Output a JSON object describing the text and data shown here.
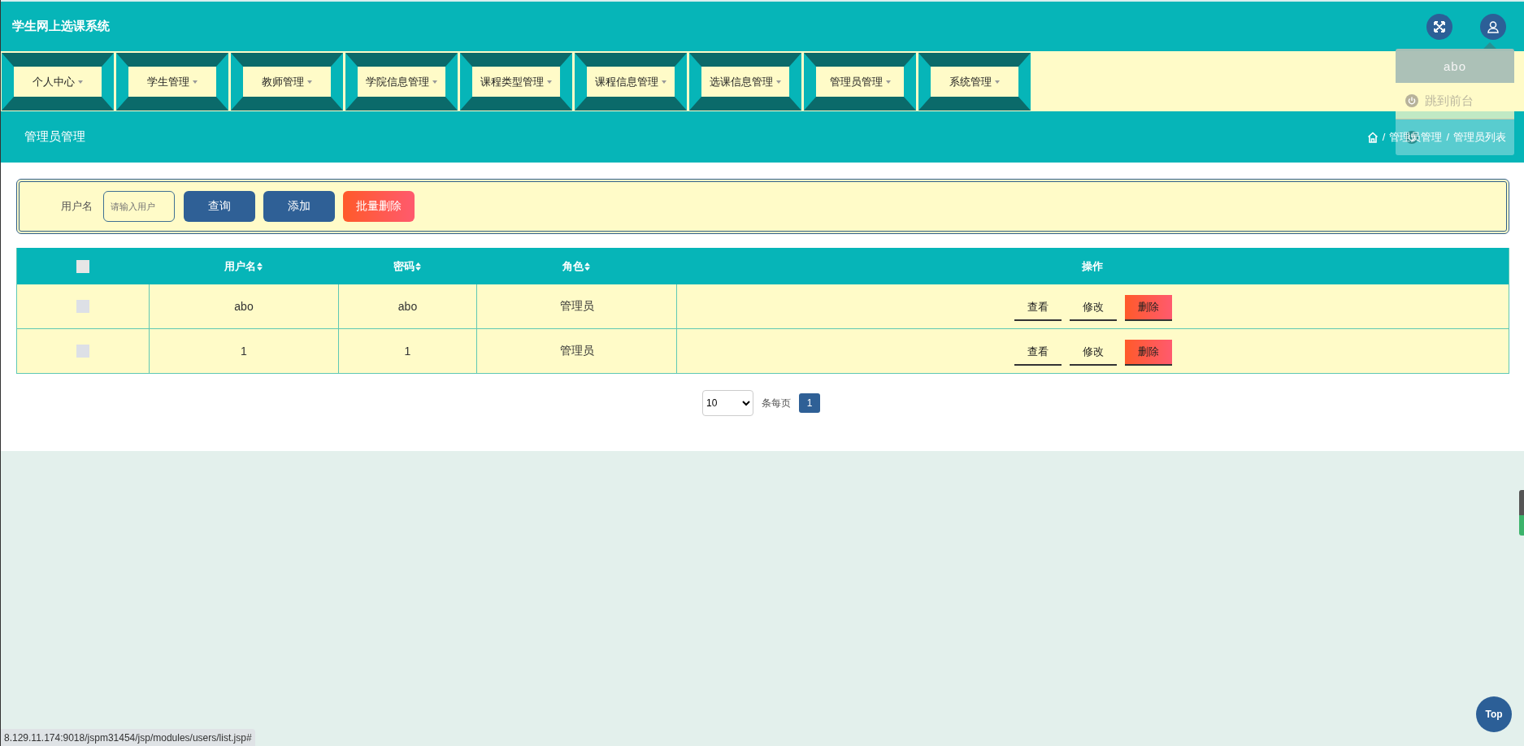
{
  "header": {
    "title": "学生网上选课系统"
  },
  "user_menu": {
    "username": "abo",
    "items": [
      {
        "label": "跳到前台",
        "kind": "front"
      },
      {
        "kind": "logout"
      }
    ]
  },
  "nav": [
    {
      "label": "个人中心"
    },
    {
      "label": "学生管理"
    },
    {
      "label": "教师管理"
    },
    {
      "label": "学院信息管理"
    },
    {
      "label": "课程类型管理"
    },
    {
      "label": "课程信息管理"
    },
    {
      "label": "选课信息管理"
    },
    {
      "label": "管理员管理"
    },
    {
      "label": "系统管理"
    }
  ],
  "page_title": "管理员管理",
  "breadcrumb": [
    {
      "separator": "/",
      "label": "管理员管理"
    },
    {
      "separator": "/",
      "label": "管理员列表"
    }
  ],
  "search": {
    "label": "用户名",
    "placeholder": "请输入用户",
    "buttons": [
      {
        "label": "查询",
        "kind": "primary"
      },
      {
        "label": "添加",
        "kind": "primary"
      },
      {
        "label": "批量删除",
        "kind": "danger"
      }
    ]
  },
  "table": {
    "select_all_checked": false,
    "columns": [
      {
        "label": "用户名",
        "sortable": true
      },
      {
        "label": "密码",
        "sortable": true
      },
      {
        "label": "角色",
        "sortable": true
      },
      {
        "label": "操作",
        "sortable": false
      }
    ],
    "rows": [
      {
        "checked": false,
        "cells": [
          "abo",
          "abo",
          "管理员"
        ],
        "actions": [
          {
            "label": "查看",
            "kind": "view"
          },
          {
            "label": "修改",
            "kind": "edit"
          },
          {
            "label": "删除",
            "kind": "delete"
          }
        ]
      },
      {
        "checked": false,
        "cells": [
          "1",
          "1",
          "管理员"
        ],
        "actions": [
          {
            "label": "查看",
            "kind": "view"
          },
          {
            "label": "修改",
            "kind": "edit"
          },
          {
            "label": "删除",
            "kind": "delete"
          }
        ]
      }
    ]
  },
  "pagination": {
    "page_size": "10",
    "per_page_label": "条每页",
    "pages": [
      {
        "label": "1",
        "selected": true
      }
    ]
  },
  "status_url": "8.129.11.174:9018/jspm31454/jsp/modules/users/list.jsp#",
  "top_button": "Top"
}
